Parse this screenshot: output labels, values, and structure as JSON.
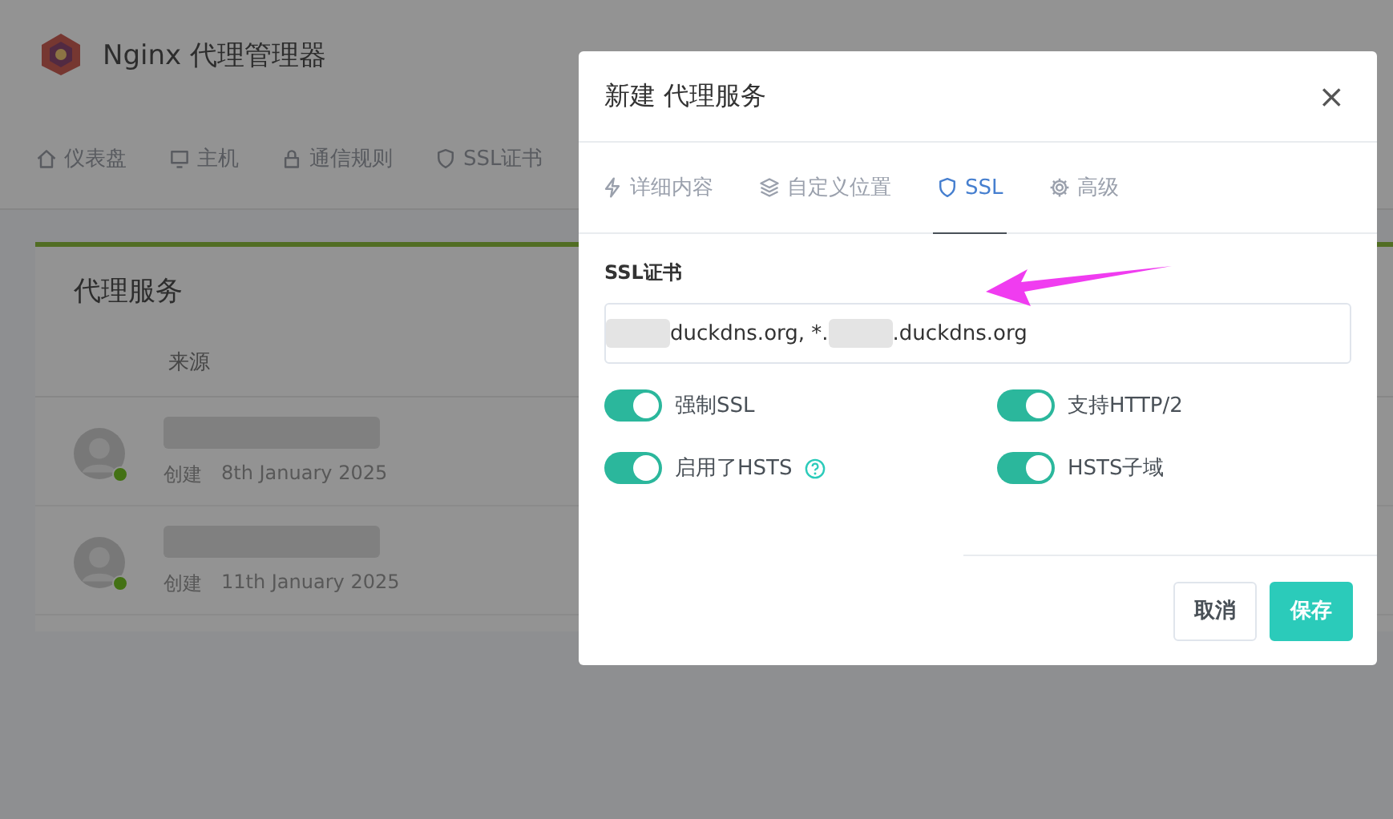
{
  "app": {
    "title": "Nginx 代理管理器"
  },
  "nav": [
    {
      "label": "仪表盘"
    },
    {
      "label": "主机"
    },
    {
      "label": "通信规则"
    },
    {
      "label": "SSL证书"
    }
  ],
  "card": {
    "title": "代理服务",
    "columns": [
      "来源"
    ],
    "rows": [
      {
        "meta_label": "创建",
        "date": "8th January 2025"
      },
      {
        "meta_label": "创建",
        "date": "11th January 2025"
      }
    ]
  },
  "modal": {
    "title": "新建 代理服务",
    "close": "×",
    "tabs": [
      {
        "label": "详细内容",
        "selected": false
      },
      {
        "label": "自定义位置",
        "selected": false
      },
      {
        "label": "SSL",
        "selected": true
      },
      {
        "label": "高级",
        "selected": false
      }
    ],
    "certificate": {
      "label": "SSL证书",
      "value_parts": [
        {
          "kind": "redacted"
        },
        {
          "kind": "text",
          "text": "duckdns.org, *."
        },
        {
          "kind": "redacted"
        },
        {
          "kind": "text",
          "text": ".duckdns.org"
        }
      ]
    },
    "toggles": [
      {
        "label": "强制SSL",
        "on": true,
        "help": false
      },
      {
        "label": "支持HTTP/2",
        "on": true,
        "help": false
      },
      {
        "label": "启用了HSTS",
        "on": true,
        "help": true
      },
      {
        "label": "HSTS子域",
        "on": true,
        "help": false
      }
    ],
    "buttons": [
      {
        "label": "取消",
        "kind": "secondary"
      },
      {
        "label": "保存",
        "kind": "primary"
      }
    ]
  }
}
